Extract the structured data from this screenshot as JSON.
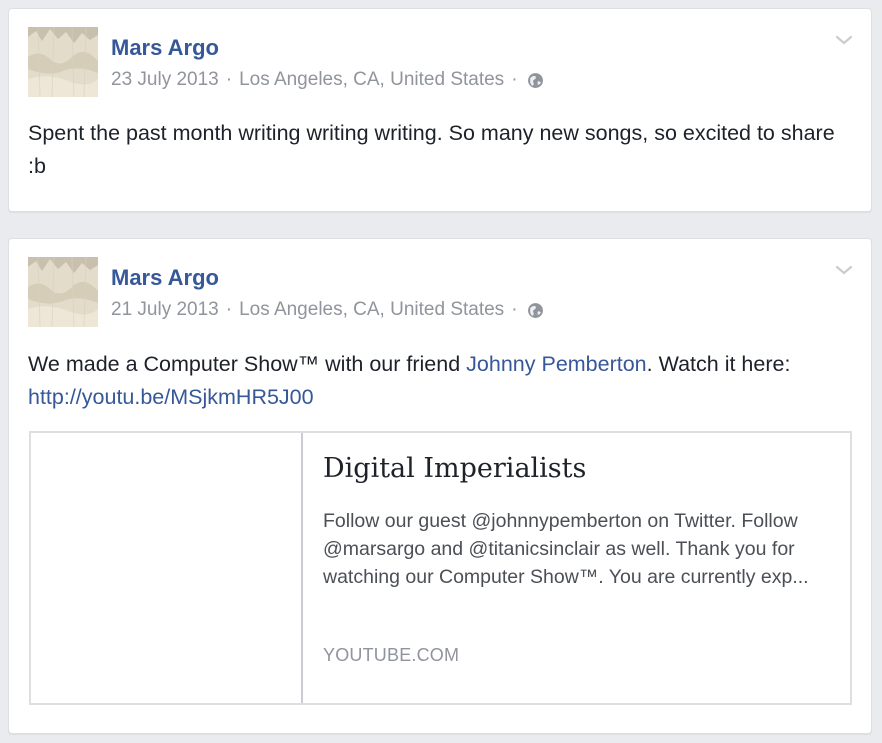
{
  "posts": [
    {
      "author": "Mars Argo",
      "date": "23 July 2013",
      "location": "Los Angeles, CA, United States",
      "separator": "·",
      "privacy_icon": "globe-icon",
      "text": "Spent the past month writing writing writing. So many new songs, so excited to share :b"
    },
    {
      "author": "Mars Argo",
      "date": "21 July 2013",
      "location": "Los Angeles, CA, United States",
      "separator": "·",
      "privacy_icon": "globe-icon",
      "text_before": "We made a Computer Show™ with our friend ",
      "mention": "Johnny Pemberton",
      "text_middle": ". Watch it here: ",
      "link": "http://youtu.be/MSjkmHR5J00",
      "attachment": {
        "title": "Digital Imperialists",
        "description": "Follow our guest @johnnypemberton on Twitter. Follow @marsargo and @titanicsinclair as well. Thank you for watching our Computer Show™. You are currently exp...",
        "domain": "YOUTUBE.COM"
      }
    }
  ],
  "colors": {
    "author": "#365899",
    "meta": "#90949c",
    "text": "#1d2129",
    "background": "#e9ebee"
  }
}
